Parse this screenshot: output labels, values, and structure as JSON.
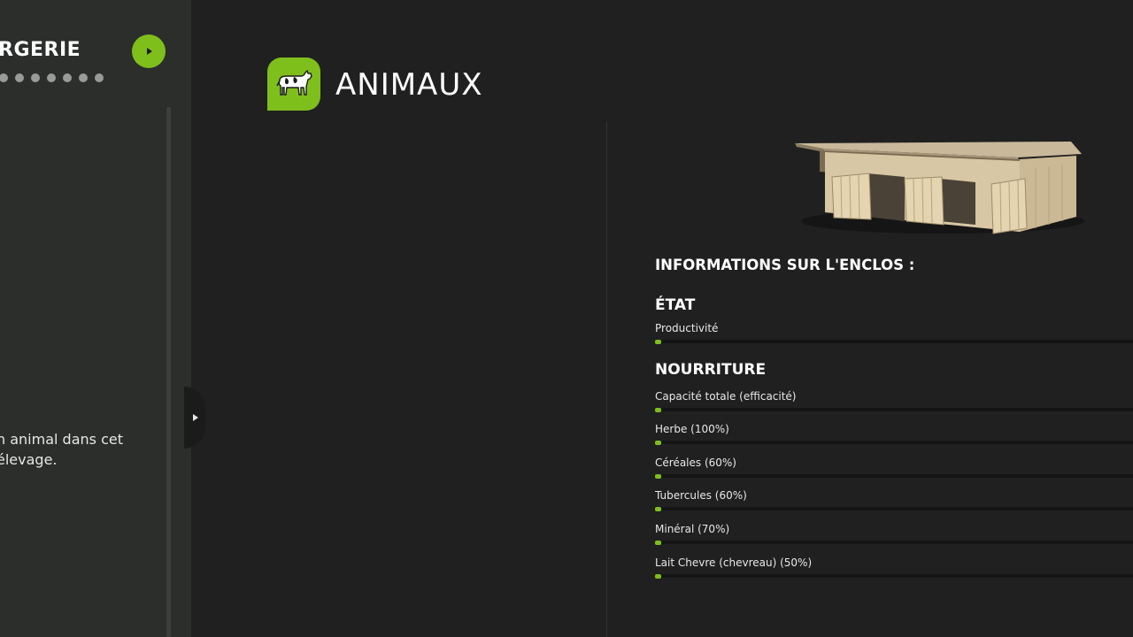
{
  "sidebar": {
    "title": "RGERIE",
    "page_count": 7,
    "empty_message": "n animal dans cet élevage."
  },
  "header": {
    "title": "ANIMAUX",
    "icon": "cow-icon"
  },
  "info": {
    "heading": "INFORMATIONS SUR L'ENCLOS :",
    "state": {
      "title": "ÉTAT",
      "stats": [
        {
          "label": "Productivité",
          "value": 0
        }
      ]
    },
    "food": {
      "title": "NOURRITURE",
      "stats": [
        {
          "label": "Capacité totale (efficacité)",
          "value": 0
        },
        {
          "label": "Herbe (100%)",
          "value": 0
        },
        {
          "label": "Céréales (60%)",
          "value": 0
        },
        {
          "label": "Tubercules (60%)",
          "value": 0
        },
        {
          "label": "Minéral (70%)",
          "value": 0
        },
        {
          "label": "Lait Chevre (chevreau) (50%)",
          "value": 0
        }
      ]
    }
  },
  "colors": {
    "accent": "#7fbf1c",
    "background": "#202020",
    "sidebar": "#2b2e2b"
  }
}
